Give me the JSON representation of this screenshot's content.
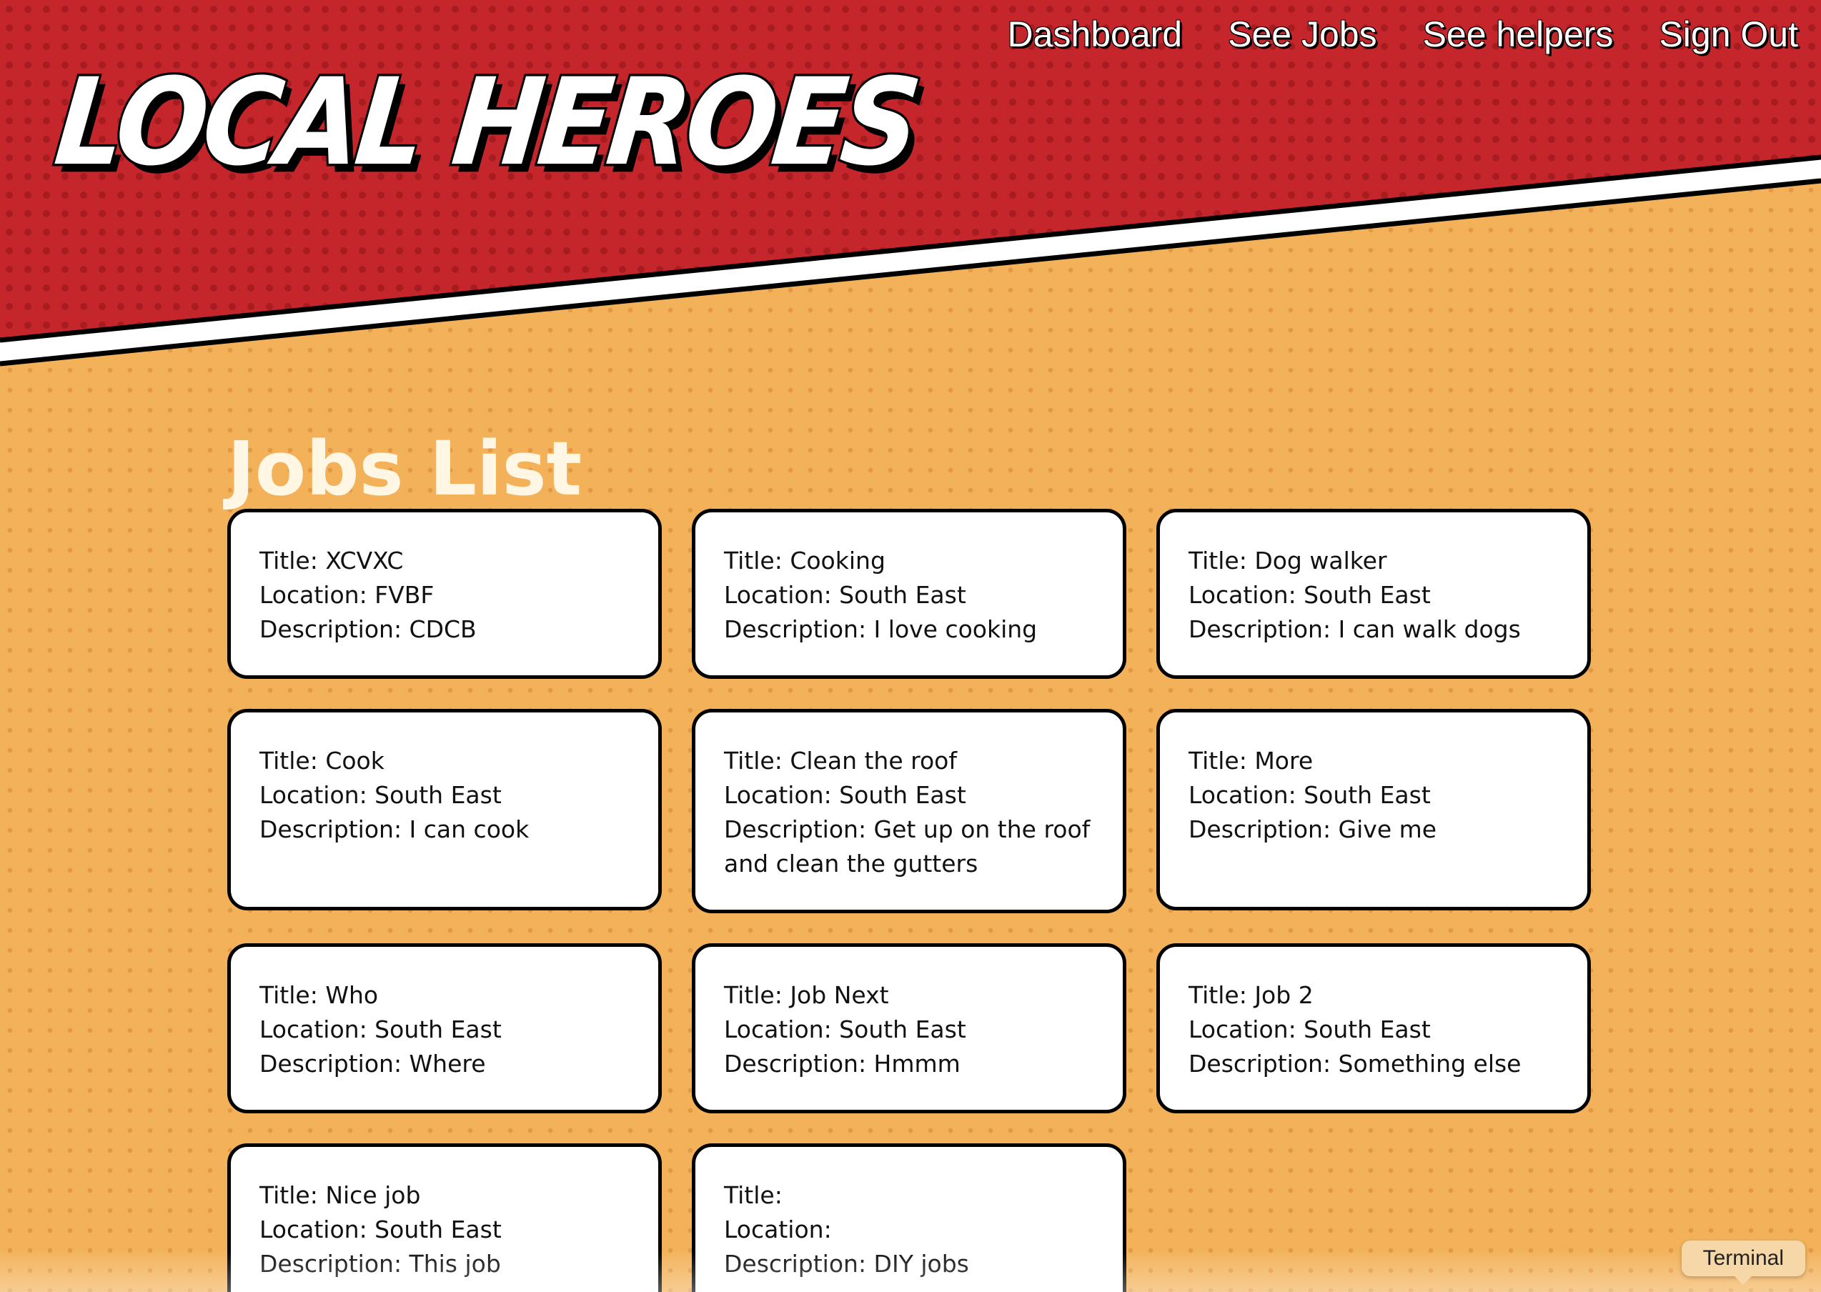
{
  "app": {
    "logo_text": "LOCAL HEROES"
  },
  "nav": {
    "items": [
      {
        "label": "Dashboard"
      },
      {
        "label": "See Jobs"
      },
      {
        "label": "See helpers"
      },
      {
        "label": "Sign Out"
      }
    ]
  },
  "main": {
    "title": "Jobs List",
    "jobs": [
      {
        "title_line": "Title: XCVXC",
        "location_line": "Location: FVBF",
        "description_line": "Description: CDCB"
      },
      {
        "title_line": "Title: Cooking",
        "location_line": "Location: South East",
        "description_line": "Description: I love cooking"
      },
      {
        "title_line": "Title: Dog walker",
        "location_line": "Location: South East",
        "description_line": "Description: I can walk dogs"
      },
      {
        "title_line": "Title: Cook",
        "location_line": "Location: South East",
        "description_line": "Description: I can cook"
      },
      {
        "title_line": "Title: Clean the roof",
        "location_line": "Location: South East",
        "description_line": "Description: Get up on the roof and clean the gutters"
      },
      {
        "title_line": "Title: More",
        "location_line": "Location: South East",
        "description_line": "Description: Give me"
      },
      {
        "title_line": "Title: Who",
        "location_line": "Location: South East",
        "description_line": "Description: Where"
      },
      {
        "title_line": "Title: Job Next",
        "location_line": "Location: South East",
        "description_line": "Description: Hmmm"
      },
      {
        "title_line": "Title: Job 2",
        "location_line": "Location: South East",
        "description_line": "Description: Something else"
      },
      {
        "title_line": "Title: Nice job",
        "location_line": "Location: South East",
        "description_line": "Description: This job"
      },
      {
        "title_line": "Title:",
        "location_line": "Location:",
        "description_line": "Description: DIY jobs"
      }
    ]
  },
  "tooltip": {
    "label": "Terminal"
  },
  "colors": {
    "header_red": "#c4262b",
    "page_orange": "#f3b25a",
    "card_bg": "#ffffff",
    "card_border": "#000000"
  }
}
